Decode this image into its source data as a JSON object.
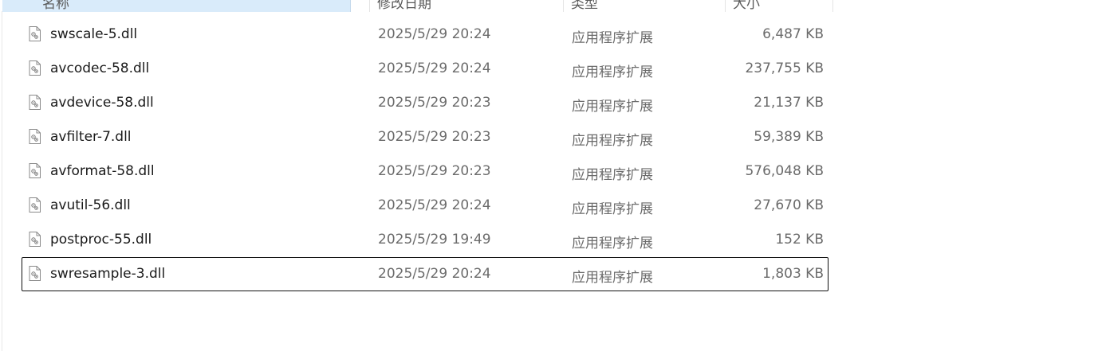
{
  "header": {
    "columns": [
      {
        "label": "名称"
      },
      {
        "label": "修改日期"
      },
      {
        "label": "类型"
      },
      {
        "label": "大小"
      }
    ]
  },
  "files": [
    {
      "name": "swscale-5.dll",
      "date": "2025/5/29 20:24",
      "type": "应用程序扩展",
      "size": "6,487 KB",
      "icon": "dll-file-icon"
    },
    {
      "name": "avcodec-58.dll",
      "date": "2025/5/29 20:24",
      "type": "应用程序扩展",
      "size": "237,755 KB",
      "icon": "dll-file-icon"
    },
    {
      "name": "avdevice-58.dll",
      "date": "2025/5/29 20:23",
      "type": "应用程序扩展",
      "size": "21,137 KB",
      "icon": "dll-file-icon"
    },
    {
      "name": "avfilter-7.dll",
      "date": "2025/5/29 20:23",
      "type": "应用程序扩展",
      "size": "59,389 KB",
      "icon": "dll-file-icon"
    },
    {
      "name": "avformat-58.dll",
      "date": "2025/5/29 20:23",
      "type": "应用程序扩展",
      "size": "576,048 KB",
      "icon": "dll-file-icon"
    },
    {
      "name": "avutil-56.dll",
      "date": "2025/5/29 20:24",
      "type": "应用程序扩展",
      "size": "27,670 KB",
      "icon": "dll-file-icon"
    },
    {
      "name": "postproc-55.dll",
      "date": "2025/5/29 19:49",
      "type": "应用程序扩展",
      "size": "152 KB",
      "icon": "dll-file-icon"
    },
    {
      "name": "swresample-3.dll",
      "date": "2025/5/29 20:24",
      "type": "应用程序扩展",
      "size": "1,803 KB",
      "icon": "dll-file-icon"
    }
  ],
  "colors": {
    "header_selected_bg": "#d9ebfa",
    "focus_border": "#111111",
    "secondary_text": "#6b6b6b"
  }
}
